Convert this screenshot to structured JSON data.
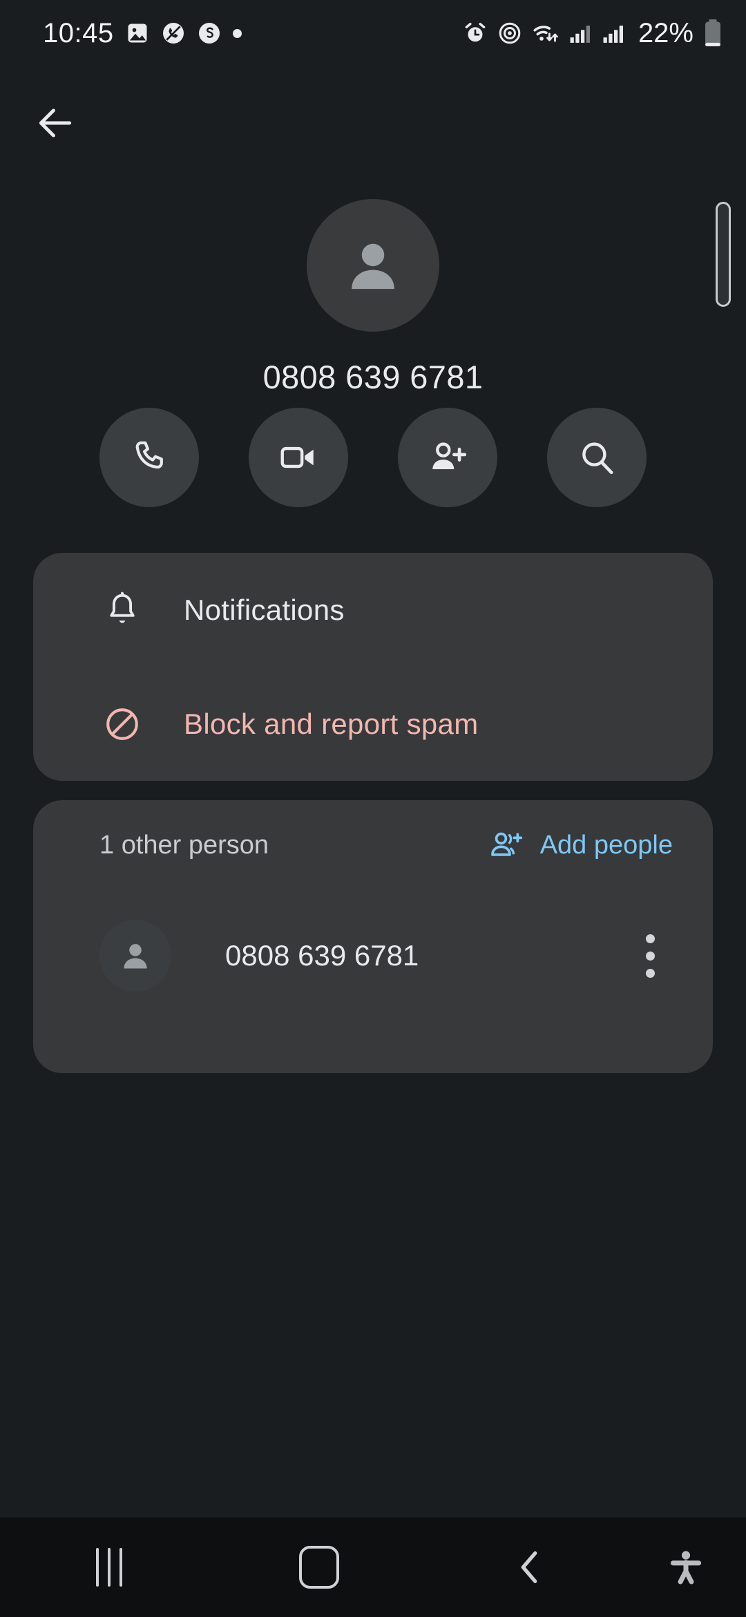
{
  "status_bar": {
    "time": "10:45",
    "battery_percent": "22%",
    "left_icons": [
      "image-icon",
      "missed-call-icon",
      "s-app-icon",
      "dot-indicator"
    ],
    "right_icons": [
      "alarm-icon",
      "hotspot-icon",
      "wifi-icon",
      "signal-bars-sim1-icon",
      "signal-bars-sim2-icon",
      "battery-icon"
    ]
  },
  "top_bar": {
    "back_icon": "arrow-left-icon"
  },
  "header": {
    "avatar_icon": "person-avatar-icon",
    "title": "0808 639 6781"
  },
  "actions": [
    {
      "name": "call",
      "icon": "phone-icon"
    },
    {
      "name": "video-call",
      "icon": "video-camera-icon"
    },
    {
      "name": "add-contact",
      "icon": "person-add-icon"
    },
    {
      "name": "search",
      "icon": "search-icon"
    }
  ],
  "settings_card": {
    "rows": [
      {
        "name": "notifications",
        "icon": "bell-icon",
        "label": "Notifications",
        "style": "default"
      },
      {
        "name": "block-report-spam",
        "icon": "block-icon",
        "label": "Block and report spam",
        "style": "danger"
      }
    ]
  },
  "people_card": {
    "count_label": "1 other person",
    "add_people_label": "Add people",
    "add_people_icon": "person-add-icon",
    "members": [
      {
        "name": "0808 639 6781",
        "avatar_icon": "person-avatar-icon",
        "overflow_icon": "more-vertical-icon"
      }
    ]
  },
  "nav_bar": {
    "recents_icon": "recents-icon",
    "home_icon": "home-icon",
    "back_icon": "chevron-left-icon",
    "accessibility_icon": "accessibility-icon"
  },
  "colors": {
    "background": "#1a1d1f",
    "card": "#37393b",
    "accent_blue": "#7fc8f5",
    "danger": "#f4b6b0",
    "text_primary": "#e8eaed",
    "text_secondary": "#c9cdd0",
    "nav_background": "#0d0f10"
  }
}
